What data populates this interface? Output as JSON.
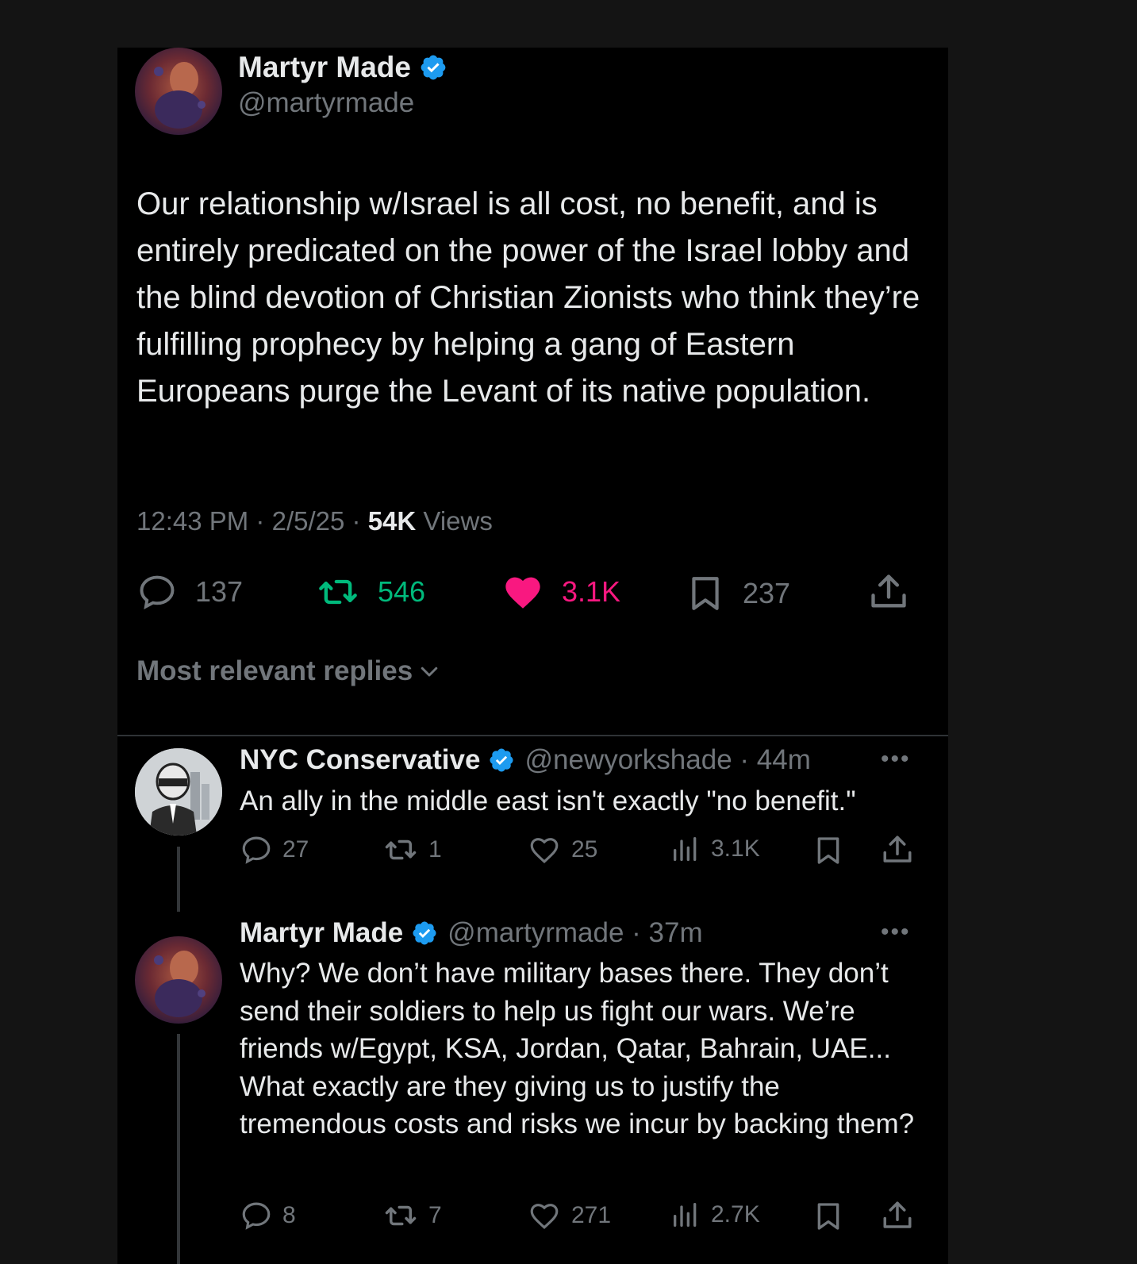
{
  "main_tweet": {
    "author_name": "Martyr Made",
    "handle": "@martyrmade",
    "text": "Our relationship w/Israel is all cost, no benefit, and is entirely predicated on the power of the Israel lobby and the blind devotion of Christian Zionists who think they’re fulfilling prophecy by helping a gang of Eastern Europeans purge the Levant of its native population.",
    "time": "12:43 PM",
    "date": "2/5/25",
    "views_count": "54K",
    "views_label": "Views",
    "replies": "137",
    "reposts": "546",
    "likes": "3.1K",
    "bookmarks": "237"
  },
  "sort_label": "Most relevant replies",
  "replies": [
    {
      "author_name": "NYC Conservative",
      "handle": "@newyorkshade",
      "time": "44m",
      "text": "An ally in the middle east isn't exactly \"no benefit.\"",
      "replies": "27",
      "reposts": "1",
      "likes": "25",
      "views": "3.1K"
    },
    {
      "author_name": "Martyr Made",
      "handle": "@martyrmade",
      "time": "37m",
      "text": "Why? We don’t have military bases there. They don’t send their soldiers to help us fight our wars. We’re friends w/Egypt, KSA, Jordan, Qatar, Bahrain, UAE... What exactly are they giving us to justify the tremendous costs and risks we incur by backing them?",
      "replies": "8",
      "reposts": "7",
      "likes": "271",
      "views": "2.7K"
    }
  ],
  "colors": {
    "verified": "#1d9bf0",
    "repost_active": "#00ba7c",
    "like_active": "#f91880",
    "muted": "#71767b"
  },
  "icons": [
    "verified-badge-icon",
    "reply-icon",
    "repost-icon",
    "like-icon",
    "bookmark-icon",
    "share-icon",
    "views-icon",
    "more-icon",
    "chevron-down-icon"
  ]
}
